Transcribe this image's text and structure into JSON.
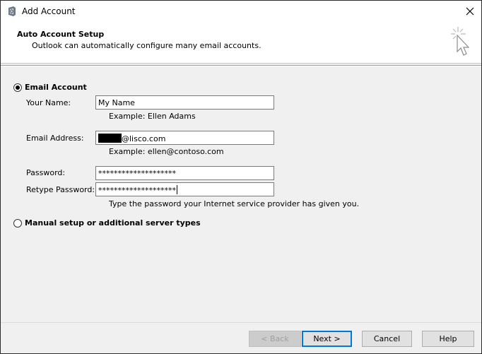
{
  "window": {
    "title": "Add Account"
  },
  "header": {
    "title": "Auto Account Setup",
    "subtitle": "Outlook can automatically configure many email accounts."
  },
  "options": {
    "email_account": {
      "label": "Email Account",
      "selected": true
    },
    "manual_setup": {
      "label": "Manual setup or additional server types",
      "selected": false
    }
  },
  "form": {
    "your_name": {
      "label": "Your Name:",
      "value": "My Name",
      "hint": "Example: Ellen Adams"
    },
    "email_address": {
      "label": "Email Address:",
      "value_suffix": "@lisco.com",
      "hint": "Example: ellen@contoso.com"
    },
    "password": {
      "label": "Password:",
      "value": "********************"
    },
    "retype_password": {
      "label": "Retype Password:",
      "value": "********************"
    },
    "password_hint": "Type the password your Internet service provider has given you."
  },
  "buttons": {
    "back": "< Back",
    "next": "Next >",
    "cancel": "Cancel",
    "help": "Help"
  },
  "colors": {
    "default_button_border": "#0078d7",
    "header_bg": "#ffffff",
    "body_bg": "#f0f0f0"
  }
}
